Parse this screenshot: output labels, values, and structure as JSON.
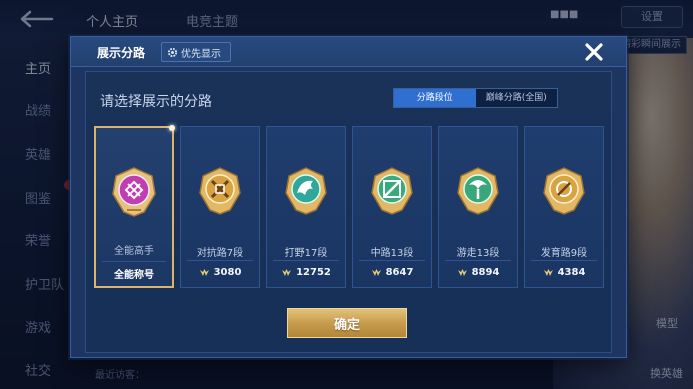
{
  "background": {
    "top_tabs": [
      "个人主页",
      "电竞主题"
    ],
    "top_right_button": "设置",
    "top_right_small": "精彩瞬间展示",
    "sidebar": [
      "主页",
      "战绩",
      "英雄",
      "图鉴",
      "荣誉",
      "护卫队",
      "游戏",
      "社交"
    ],
    "right_labels": [
      "模型",
      "换英雄"
    ],
    "bottom_text": "最近访客："
  },
  "modal": {
    "title": "展示分路",
    "priority_label": "优先显示",
    "subtitle": "请选择展示的分路",
    "segments": [
      {
        "label": "分路段位",
        "active": true
      },
      {
        "label": "巅峰分路(全国)",
        "active": false
      }
    ],
    "cards": [
      {
        "name": "全能高手",
        "title": "全能称号",
        "emblem": "all-round-emblem-icon",
        "color": "#c03fb0",
        "selected": true
      },
      {
        "name": "对抗路7段",
        "score": "3080",
        "emblem": "clash-lane-emblem-icon",
        "color": "#d9a341"
      },
      {
        "name": "打野17段",
        "score": "12752",
        "emblem": "jungle-emblem-icon",
        "color": "#2fa79a"
      },
      {
        "name": "中路13段",
        "score": "8647",
        "emblem": "mid-lane-emblem-icon",
        "color": "#3aa97e"
      },
      {
        "name": "游走13段",
        "score": "8894",
        "emblem": "roam-emblem-icon",
        "color": "#3aa77a"
      },
      {
        "name": "发育路9段",
        "score": "4384",
        "emblem": "farm-lane-emblem-icon",
        "color": "#d9a341"
      }
    ],
    "confirm_label": "确定"
  }
}
